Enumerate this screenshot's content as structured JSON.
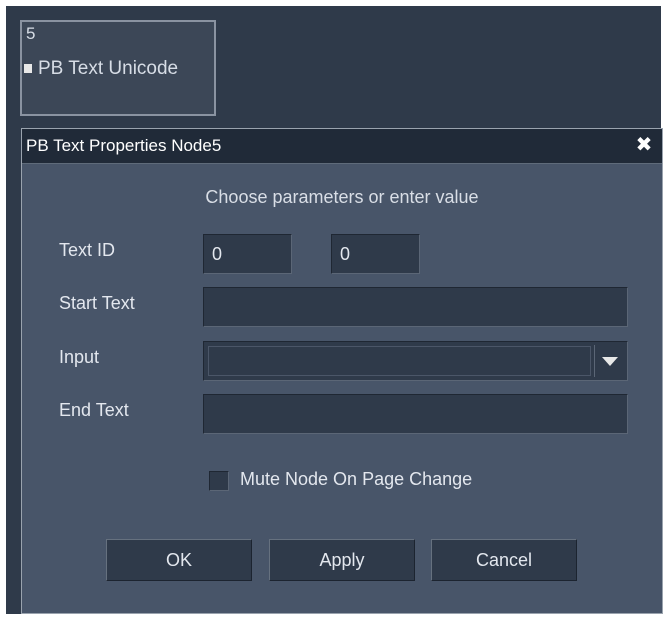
{
  "node": {
    "number": "5",
    "label": "PB Text Unicode"
  },
  "dialog": {
    "title": "PB Text Properties Node5",
    "close_label": "✕",
    "instruction": "Choose parameters or enter value",
    "fields": {
      "text_id": {
        "label": "Text ID",
        "value1": "0",
        "value2": "0"
      },
      "start_text": {
        "label": "Start Text",
        "value": ""
      },
      "input": {
        "label": "Input",
        "value": ""
      },
      "end_text": {
        "label": "End Text",
        "value": ""
      }
    },
    "mute_checkbox": {
      "label": "Mute Node On Page Change",
      "checked": false
    },
    "buttons": {
      "ok": "OK",
      "apply": "Apply",
      "cancel": "Cancel"
    }
  },
  "colors": {
    "canvas_bg": "#2f3a4a",
    "dialog_bg": "#485569",
    "titlebar_bg": "#202a38",
    "field_bg": "#2f3a4a",
    "text": "#e3e7ee"
  }
}
